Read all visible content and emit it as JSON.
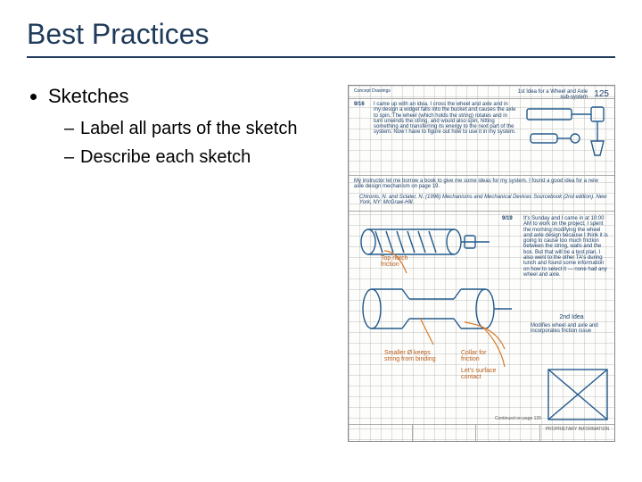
{
  "title": "Best Practices",
  "bullets": {
    "l1": "Sketches",
    "l2a": "Label all parts of the sketch",
    "l2b": "Describe each sketch"
  },
  "notebook": {
    "page_number": "125",
    "header_topic": "1st Idea for a Wheel and Axle sub-system",
    "note1_label": "9/16",
    "note1": "I came up with an idea. I cross the wheel and axle and in my design a widget falls into the bucket and causes the axle to spin. The wheel (which holds the string) rotates and in turn unwinds the string, and would also spin, hitting something and transferring its energy to the next part of the system. Now I have to figure out how to use it in my system.",
    "note2": "My instructor let me borrow a book to give me some ideas for my system. I found a good idea for a new axle design mechanism on page 19.",
    "citation": "Chironis, N. and Sclater, N. (1996) Mechanisms and Mechanical Devices Sourcebook (2nd edition). New York, NY: McGraw-Hill.",
    "note3_label": "9/19",
    "note3": "It's Sunday and I came in at 10:00 AM to work on the project. I spent the morning modifying the wheel and axle design because I think it is going to cause too much friction between the string, walls and the box. But that will be a test plan. I also went to the other TA's during lunch and found some information on how to select it — none had any wheel and axle.",
    "idea2_label": "2nd Idea",
    "idea2": "Modifies wheel and axle and incorporates friction issue",
    "anno_top": "Top notch friction",
    "anno_smaller": "Smaller Ø keeps string from binding",
    "anno_collar": "Collar for friction",
    "anno_surface": "Let's surface contact",
    "header_left": "Concept Drawings",
    "footer_cont": "Continued on page 126",
    "footer_prop": "PROPRIETARY INFORMATION"
  }
}
